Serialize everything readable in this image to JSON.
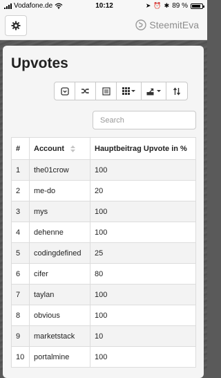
{
  "status_bar": {
    "carrier": "Vodafone.de",
    "time": "10:12",
    "battery": "89 %",
    "battery_level": 0.89
  },
  "app_bar": {
    "brand": "SteemitEva"
  },
  "page": {
    "title": "Upvotes",
    "search": {
      "placeholder": "Search",
      "value": ""
    }
  },
  "toolbar": [
    "chevron-down-circle-icon",
    "shuffle-icon",
    "list-icon",
    "grid-icon",
    "export-icon",
    "sort-icon"
  ],
  "table": {
    "headers": [
      "#",
      "Account",
      "Hauptbeitrag Upvote in %"
    ],
    "rows": [
      {
        "num": "1",
        "account": "the01crow",
        "upvote": "100"
      },
      {
        "num": "2",
        "account": "me-do",
        "upvote": "20"
      },
      {
        "num": "3",
        "account": "mys",
        "upvote": "100"
      },
      {
        "num": "4",
        "account": "dehenne",
        "upvote": "100"
      },
      {
        "num": "5",
        "account": "codingdefined",
        "upvote": "25"
      },
      {
        "num": "6",
        "account": "cifer",
        "upvote": "80"
      },
      {
        "num": "7",
        "account": "taylan",
        "upvote": "100"
      },
      {
        "num": "8",
        "account": "obvious",
        "upvote": "100"
      },
      {
        "num": "9",
        "account": "marketstack",
        "upvote": "10"
      },
      {
        "num": "10",
        "account": "portalmine",
        "upvote": "100"
      }
    ]
  }
}
